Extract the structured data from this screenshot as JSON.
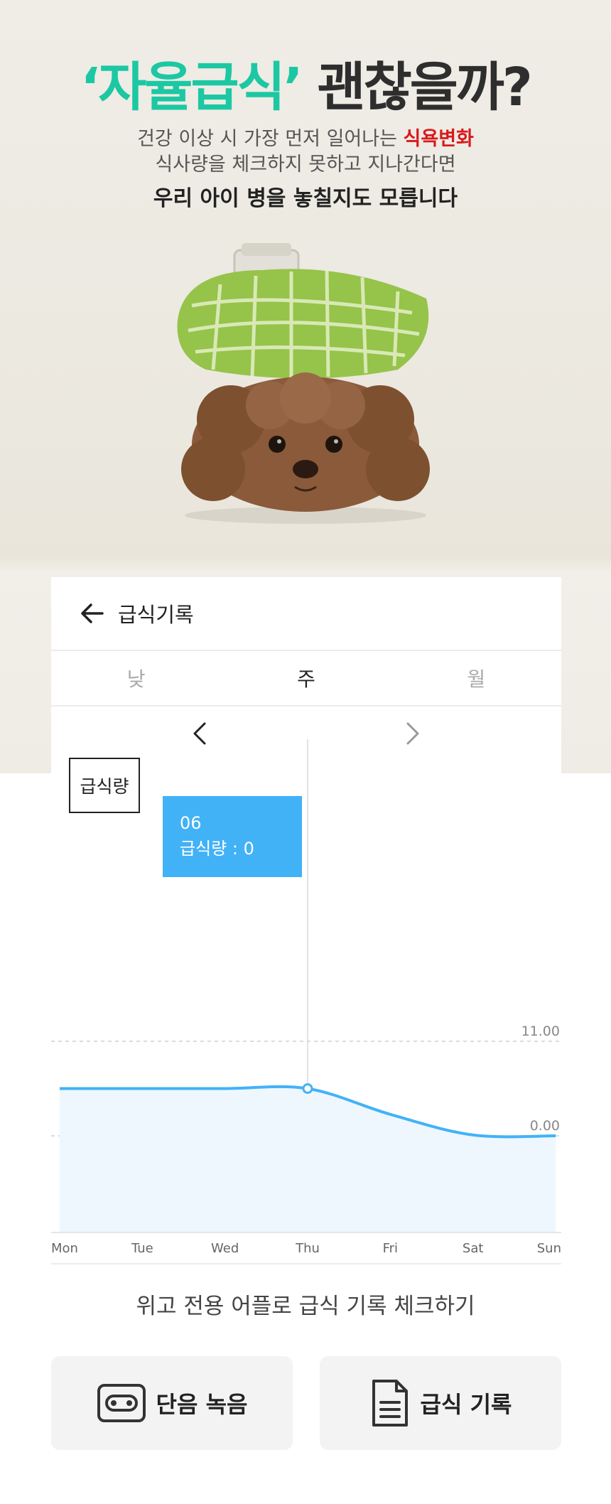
{
  "hero": {
    "title_accent": "‘자율급식’",
    "title_rest": " 괜찮을까?",
    "sub1_pre": "건강 이상 시 가장 먼저 일어나는 ",
    "sub1_red": "식욕변화",
    "sub2": "식사량을 체크하지 못하고 지나간다면",
    "sub3": "우리 아이 병을 놓칠지도 모릅니다"
  },
  "app": {
    "header_title": "급식기록",
    "tabs": [
      "낮",
      "주",
      "월"
    ],
    "active_tab": "주"
  },
  "legend_label": "급식량",
  "tooltip": {
    "line1": "06",
    "line2": "급식량 : 0"
  },
  "chart_data": {
    "type": "area",
    "categories": [
      "Mon",
      "Tue",
      "Wed",
      "Thu",
      "Fri",
      "Sat",
      "Sun"
    ],
    "series": [
      {
        "values": [
          5.5,
          5.5,
          5.5,
          5.5,
          2.5,
          0.1,
          0
        ]
      }
    ],
    "ref_lines": [
      {
        "value": 11.0,
        "label": "11.00"
      },
      {
        "value": 0.0,
        "label": "0.00"
      }
    ],
    "highlight_index": 3,
    "line_color": "#42b2f7",
    "fill_color": "#eef7fe"
  },
  "footer": {
    "caption": "위고 전용 어플로 급식 기록 체크하기",
    "btn_record": "단음 녹음",
    "btn_log": "급식 기록"
  }
}
